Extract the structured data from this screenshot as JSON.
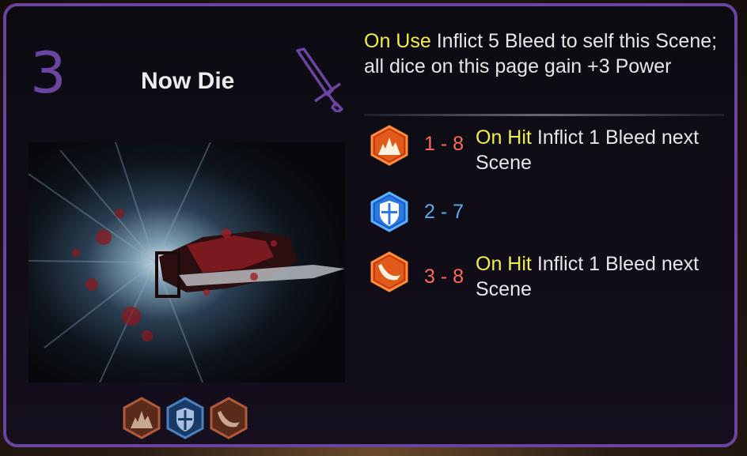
{
  "card": {
    "cost": "3",
    "name": "Now Die",
    "range_icon": "sword-icon",
    "on_use_keyword": "On Use",
    "on_use_text": "Inflict 5 Bleed to self this Scene; all dice on this page gain +3 Power",
    "colors": {
      "frame": "#6b44a0",
      "keyword": "#f4ee4a",
      "offensive_range": "#ff6a5a",
      "defensive_range": "#5aaaf0"
    }
  },
  "dice": [
    {
      "icon": "pierce-die-icon",
      "range": "1 - 8",
      "keyword": "On Hit",
      "text": "Inflict 1 Bleed next Scene",
      "type": "offensive"
    },
    {
      "icon": "block-die-icon",
      "range": "2 - 7",
      "keyword": "",
      "text": "",
      "type": "defensive"
    },
    {
      "icon": "slash-die-icon",
      "range": "3 - 8",
      "keyword": "On Hit",
      "text": "Inflict 1 Bleed next Scene",
      "type": "offensive"
    }
  ],
  "mini_dice": [
    "pierce-die-icon",
    "block-die-icon",
    "slash-die-icon"
  ]
}
